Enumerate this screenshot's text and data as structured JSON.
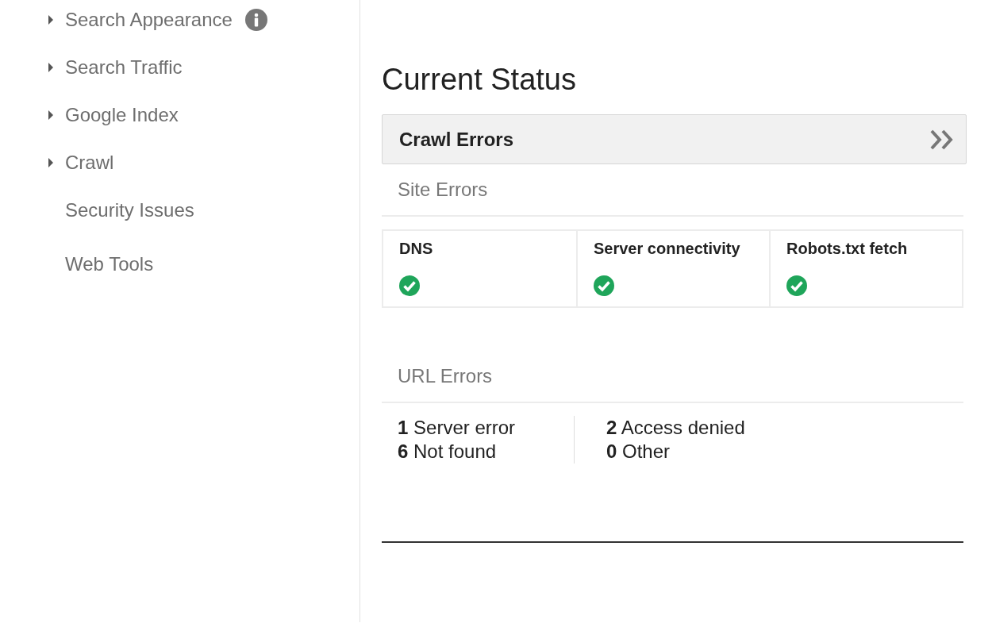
{
  "sidebar": {
    "items": [
      {
        "label": "Search Appearance",
        "expandable": true,
        "info": true
      },
      {
        "label": "Search Traffic",
        "expandable": true,
        "info": false
      },
      {
        "label": "Google Index",
        "expandable": true,
        "info": false
      },
      {
        "label": "Crawl",
        "expandable": true,
        "info": false
      },
      {
        "label": "Security Issues",
        "expandable": false,
        "info": false
      },
      {
        "label": "Web Tools",
        "expandable": false,
        "info": false
      }
    ]
  },
  "main": {
    "title": "Current Status",
    "panel": {
      "title": "Crawl Errors",
      "site_errors": {
        "heading": "Site Errors",
        "checks": [
          {
            "label": "DNS",
            "ok": true
          },
          {
            "label": "Server connectivity",
            "ok": true
          },
          {
            "label": "Robots.txt fetch",
            "ok": true
          }
        ]
      },
      "url_errors": {
        "heading": "URL Errors",
        "columns": [
          [
            "**1** Server error",
            "**6** Not found"
          ],
          [
            "**2** Access denied",
            "**0** Other"
          ]
        ]
      }
    }
  }
}
